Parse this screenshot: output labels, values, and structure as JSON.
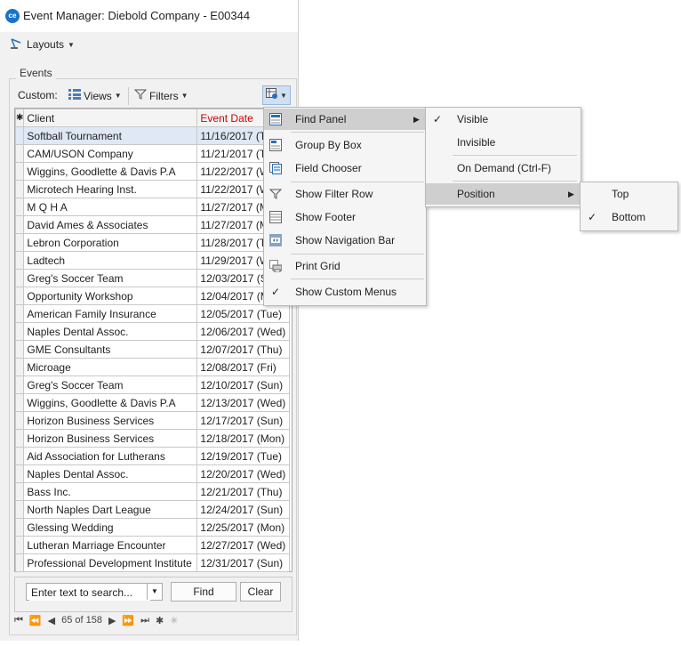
{
  "window": {
    "title": "Event Manager: Diebold Company - E00344",
    "logo_text": "ce",
    "layouts_label": "Layouts"
  },
  "events": {
    "group_label": "Events",
    "custom_label": "Custom:",
    "views_label": "Views",
    "filters_label": "Filters"
  },
  "grid": {
    "columns": [
      "Client",
      "Event Date"
    ],
    "event_date_color": "#cc0000",
    "rows": [
      [
        "Softball Tournament",
        "11/16/2017 (T"
      ],
      [
        "CAM/USON Company",
        "11/21/2017 (T"
      ],
      [
        "Wiggins, Goodlette & Davis P.A",
        "11/22/2017 (W"
      ],
      [
        "Microtech Hearing Inst.",
        "11/22/2017 (W"
      ],
      [
        "M Q H A",
        "11/27/2017 (M"
      ],
      [
        "David Ames & Associates",
        "11/27/2017 (M"
      ],
      [
        "Lebron Corporation",
        "11/28/2017 (T"
      ],
      [
        "Ladtech",
        "11/29/2017 (W"
      ],
      [
        "Greg's Soccer Team",
        "12/03/2017 (S"
      ],
      [
        "Opportunity Workshop",
        "12/04/2017 (M"
      ],
      [
        "American Family Insurance",
        "12/05/2017 (Tue)"
      ],
      [
        "Naples Dental Assoc.",
        "12/06/2017 (Wed)"
      ],
      [
        "GME Consultants",
        "12/07/2017 (Thu)"
      ],
      [
        "Microage",
        "12/08/2017 (Fri)"
      ],
      [
        "Greg's Soccer Team",
        "12/10/2017 (Sun)"
      ],
      [
        "Wiggins, Goodlette & Davis P.A",
        "12/13/2017 (Wed)"
      ],
      [
        "Horizon Business Services",
        "12/17/2017 (Sun)"
      ],
      [
        "Horizon Business Services",
        "12/18/2017 (Mon)"
      ],
      [
        "Aid Association for Lutherans",
        "12/19/2017 (Tue)"
      ],
      [
        "Naples Dental Assoc.",
        "12/20/2017 (Wed)"
      ],
      [
        "Bass Inc.",
        "12/21/2017 (Thu)"
      ],
      [
        "North Naples Dart League",
        "12/24/2017 (Sun)"
      ],
      [
        "Glessing Wedding",
        "12/25/2017 (Mon)"
      ],
      [
        "Lutheran Marriage Encounter",
        "12/27/2017 (Wed)"
      ],
      [
        "Professional Development Institute",
        "12/31/2017 (Sun)"
      ]
    ]
  },
  "search": {
    "placeholder": "Enter text to search...",
    "find_label": "Find",
    "clear_label": "Clear"
  },
  "navigator": {
    "record_text": "65 of 158"
  },
  "context_menu": {
    "items": [
      {
        "label": "Find Panel",
        "icon": "find-panel-icon"
      },
      {
        "label": "Group By Box",
        "icon": "group-by-box-icon"
      },
      {
        "label": "Field Chooser",
        "icon": "field-chooser-icon"
      },
      {
        "label": "Show Filter Row",
        "icon": "filter-row-icon"
      },
      {
        "label": "Show Footer",
        "icon": "footer-icon"
      },
      {
        "label": "Show Navigation Bar",
        "icon": "navigation-bar-icon"
      },
      {
        "label": "Print Grid",
        "icon": "print-grid-icon"
      },
      {
        "label": "Show Custom Menus",
        "icon": "checkmark-icon"
      }
    ]
  },
  "find_panel_submenu": {
    "items": [
      "Visible",
      "Invisible",
      "On Demand (Ctrl-F)",
      "Position"
    ],
    "checked": "Visible"
  },
  "position_submenu": {
    "items": [
      "Top",
      "Bottom"
    ],
    "checked": "Bottom"
  },
  "colors": {
    "accent": "#1a73c8",
    "menu_highlight": "#cfcfcf",
    "selected_row": "#dfe8f4"
  }
}
